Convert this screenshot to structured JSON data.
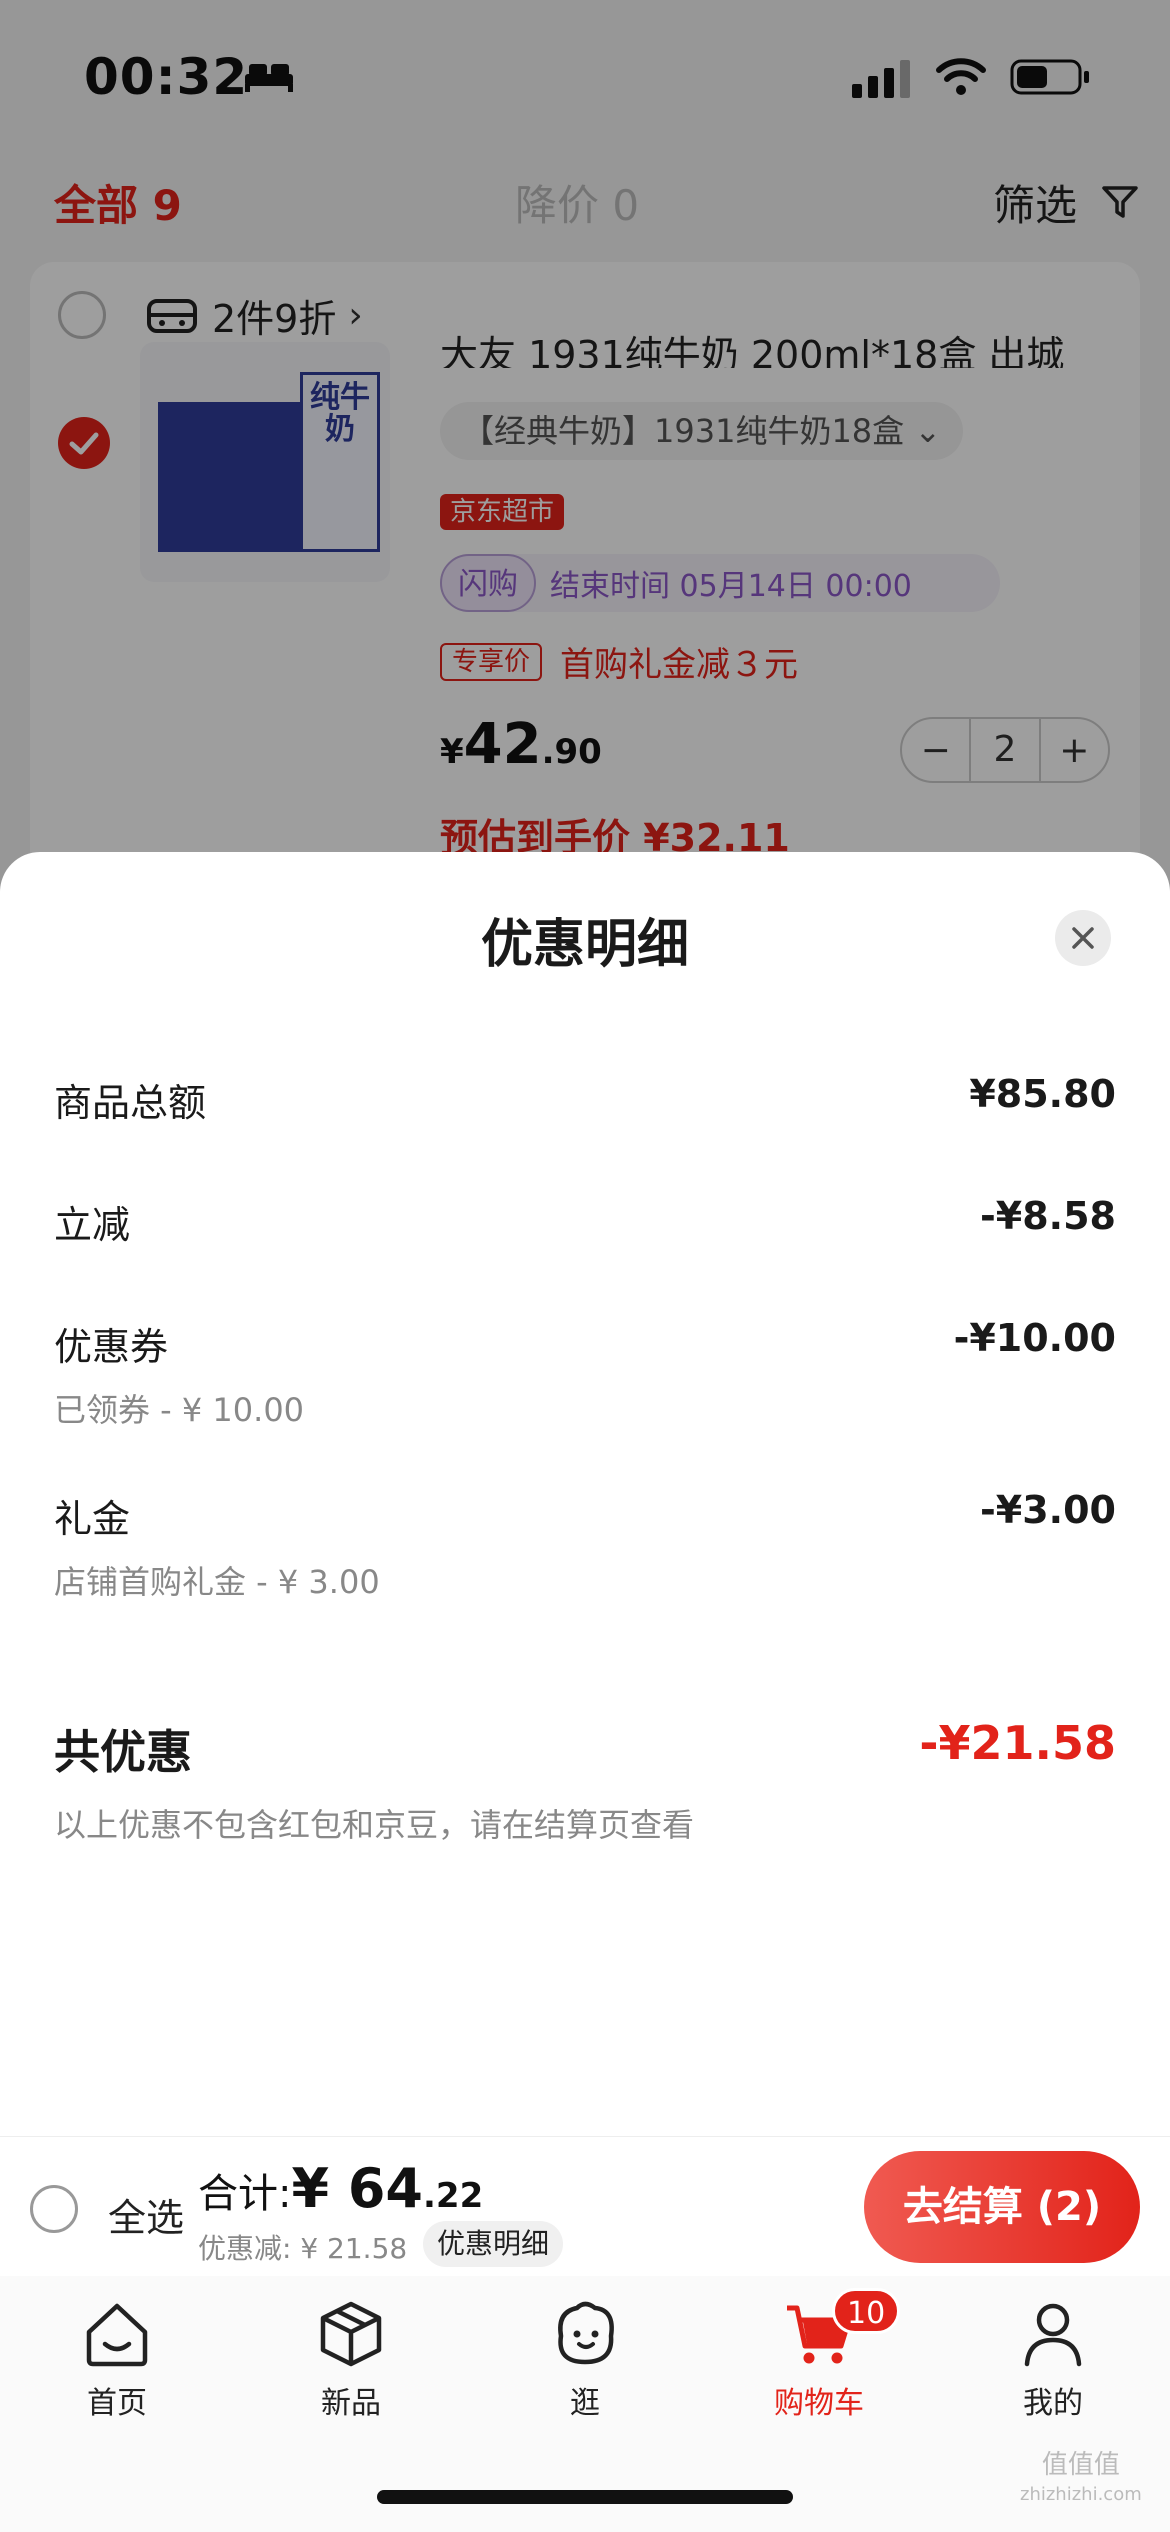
{
  "status_bar": {
    "time": "00:32"
  },
  "filter_bar": {
    "all_label": "全部 9",
    "price_drop_label": "降价 0",
    "filter_label": "筛选"
  },
  "cart_item": {
    "promo": "2件9折",
    "title": "大友 1931纯牛奶 200ml*18盒 出城",
    "spec": "【经典牛奶】1931纯牛奶18盒 ⌄",
    "store_tag": "京东超市",
    "flash_tag": "闪购",
    "flash_end": "结束时间 05月14日 00:00",
    "vip_tag": "专享价",
    "vip_text": "首购礼金减３元",
    "price_symbol": "¥",
    "price_int": "42",
    "price_dec": ".90",
    "quantity": "2",
    "minus": "−",
    "plus": "+",
    "estimate": "预估到手价 ¥32.11",
    "box_label": "纯牛奶"
  },
  "sheet": {
    "title": "优惠明细",
    "rows": [
      {
        "label": "商品总额",
        "value": "¥85.80",
        "sub": ""
      },
      {
        "label": "立减",
        "value": "-¥8.58",
        "sub": ""
      },
      {
        "label": "优惠券",
        "value": "-¥10.00",
        "sub": "已领券 - ¥ 10.00"
      },
      {
        "label": "礼金",
        "value": "-¥3.00",
        "sub": "店铺首购礼金 - ¥ 3.00"
      }
    ],
    "total_label": "共优惠",
    "total_value": "-¥21.58",
    "total_note": "以上优惠不包含红包和京豆，请在结算页查看"
  },
  "checkout": {
    "select_all": "全选",
    "sum_label": "合计:",
    "sum_symbol": "¥ ",
    "sum_int": "64",
    "sum_dec": ".22",
    "discount_line": "优惠减: ¥ 21.58",
    "discount_detail": "优惠明细",
    "checkout_button": "去结算 (2)"
  },
  "tabs": [
    {
      "label": "首页",
      "icon": "home-icon"
    },
    {
      "label": "新品",
      "icon": "box-icon"
    },
    {
      "label": "逛",
      "icon": "face-icon"
    },
    {
      "label": "购物车",
      "icon": "cart-icon",
      "badge": "10"
    },
    {
      "label": "我的",
      "icon": "person-icon"
    }
  ],
  "watermark": {
    "line1": "值值值",
    "line2": "zhizhizhi.com"
  },
  "colors": {
    "accent": "#e2231a",
    "flash": "#8b57c7"
  }
}
